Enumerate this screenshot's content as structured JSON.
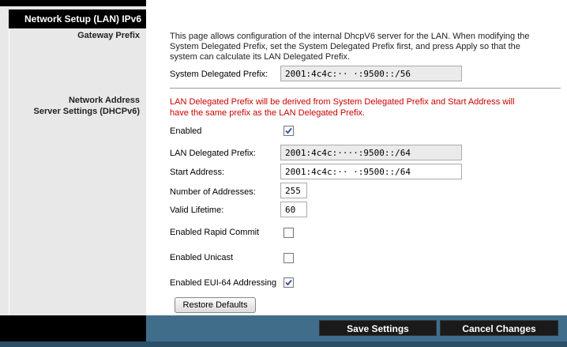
{
  "sidebar": {
    "title": "Network Setup (LAN) IPv6",
    "gateway_prefix_label": "Gateway Prefix",
    "server_settings_label_1": "Network Address",
    "server_settings_label_2": "Server Settings (DHCPv6)"
  },
  "gateway": {
    "description": "This page allows configuration of the internal DhcpV6 server for the LAN. When modifying the System Delegated Prefix, set the System Delegated Prefix first, and press Apply so that the system can calculate its LAN Delegated Prefix.",
    "system_prefix_label": "System Delegated Prefix:",
    "system_prefix_value": "2001:4c4c:·· ·:9500::/56"
  },
  "dhcp": {
    "note": "LAN Delegated Prefix will be derived from System Delegated Prefix and Start Address will have the same prefix as the LAN Delegated Prefix.",
    "enabled_label": "Enabled",
    "enabled_checked": true,
    "lan_prefix_label": "LAN Delegated Prefix:",
    "lan_prefix_value": "2001:4c4c:····:9500::/64",
    "start_address_label": "Start Address:",
    "start_address_value": "2001:4c4c:·· ·:9500::/64",
    "num_addresses_label": "Number of Addresses:",
    "num_addresses_value": "255",
    "valid_lifetime_label": "Valid Lifetime:",
    "valid_lifetime_value": "60",
    "rapid_commit_label": "Enabled Rapid Commit",
    "rapid_commit_checked": false,
    "unicast_label": "Enabled Unicast",
    "unicast_checked": false,
    "eui64_label": "Enabled EUI-64 Addressing",
    "eui64_checked": true,
    "restore_label": "Restore Defaults"
  },
  "footer": {
    "save_label": "Save Settings",
    "cancel_label": "Cancel Changes"
  },
  "colors": {
    "accent": "#3f6d8a",
    "note_red": "#cc0000"
  }
}
